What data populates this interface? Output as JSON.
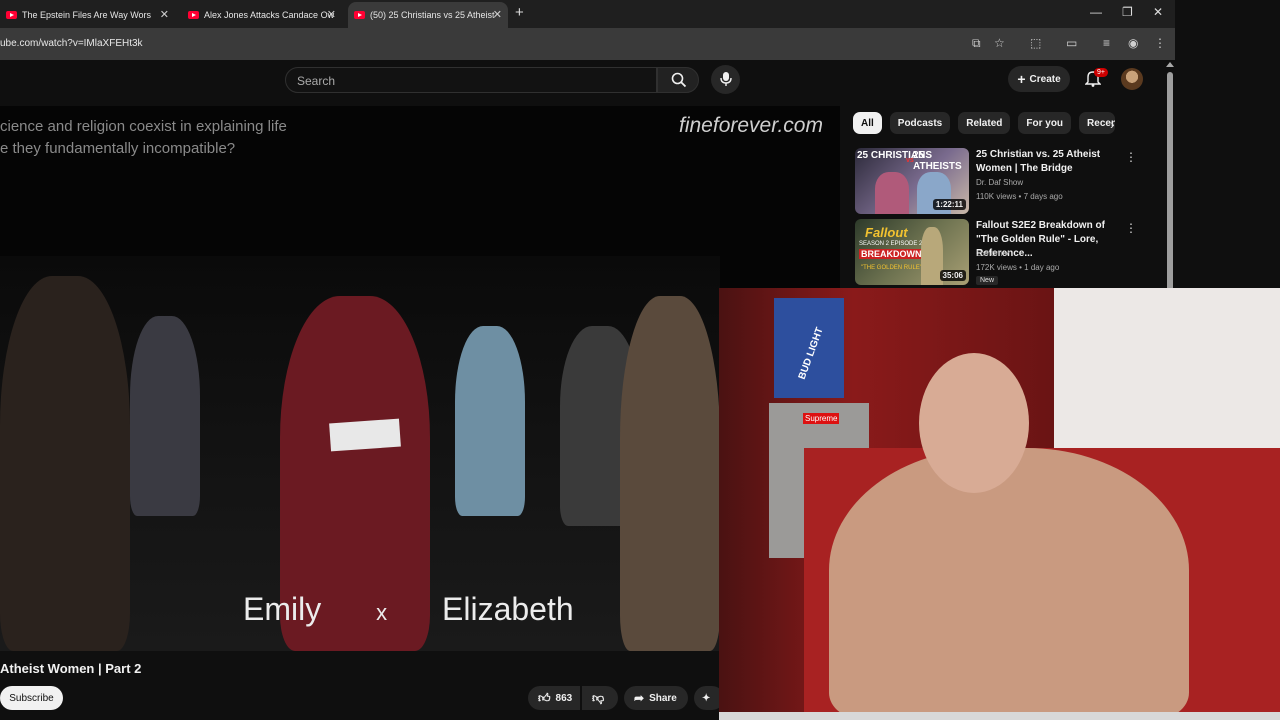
{
  "browser": {
    "tabs": [
      {
        "title": "The Epstein Files Are Way Wors",
        "active": false
      },
      {
        "title": "Alex Jones Attacks Candace Ow",
        "active": false
      },
      {
        "title": "(50) 25 Christians vs 25 Atheist",
        "active": true
      }
    ],
    "new_tab_symbol": "+",
    "url": "ube.com/watch?v=IMlaXFEHt3k"
  },
  "header": {
    "search_placeholder": "Search",
    "create_label": "Create",
    "notification_badge": "9+"
  },
  "video": {
    "question_line_1": "cience and religion coexist in explaining life",
    "question_line_2": "e they fundamentally incompatible?",
    "watermark": "fineforever.com",
    "name_left": "Emily",
    "name_sep": "x",
    "name_right": "Elizabeth",
    "title": "Atheist Women | Part 2",
    "subscribe_label": "Subscribe",
    "likes": "863",
    "share_label": "Share"
  },
  "sidebar": {
    "chips": [
      {
        "label": "All",
        "selected": true
      },
      {
        "label": "Podcasts",
        "selected": false
      },
      {
        "label": "Related",
        "selected": false
      },
      {
        "label": "For you",
        "selected": false
      },
      {
        "label": "Recen",
        "selected": false
      }
    ],
    "recommendations": [
      {
        "title": "25 Christian vs. 25 Atheist Women | The Bridge",
        "channel": "Dr. Daf Show",
        "meta": "110K views • 7 days ago",
        "duration": "1:22:11",
        "thumb_text_1": "25 CHRISTIANS",
        "thumb_text_2": "25 ATHEISTS",
        "thumb_vs": "vs",
        "new": ""
      },
      {
        "title": "Fallout S2E2 Breakdown of \"The Golden Rule\" - Lore, Reference...",
        "channel": "Oxhorn",
        "meta": "172K views • 1 day ago",
        "duration": "35:06",
        "thumb_text_1": "Fallout",
        "thumb_text_2": "BREAKDOWN",
        "thumb_text_3": "SEASON 2 EPISODE 2",
        "thumb_text_4": "\"THE GOLDEN RULE\"",
        "new": "New"
      }
    ]
  },
  "webcam": {
    "box_brand": "BUD LIGHT",
    "sticker": "Supreme"
  }
}
